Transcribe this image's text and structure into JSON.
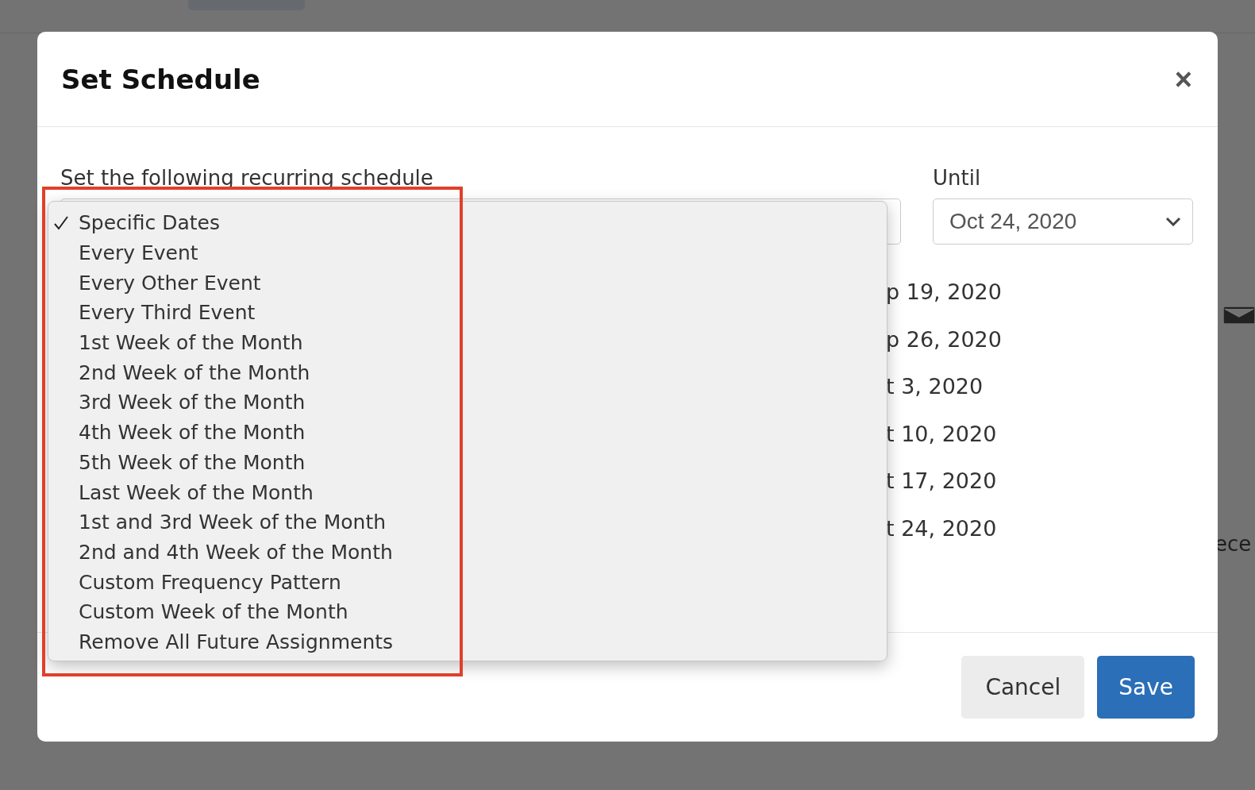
{
  "background": {
    "text": "ece"
  },
  "dialog": {
    "title": "Set Schedule",
    "close": "×",
    "schedule_label": "Set the following recurring schedule",
    "until_label": "Until",
    "until_value": "Oct 24, 2020",
    "dates": [
      "p 19, 2020",
      "p 26, 2020",
      "t 3, 2020",
      "t 10, 2020",
      "t 17, 2020",
      "t 24, 2020"
    ],
    "dropdown": [
      {
        "label": "Specific Dates",
        "selected": true
      },
      {
        "label": "Every Event",
        "selected": false
      },
      {
        "label": "Every Other Event",
        "selected": false
      },
      {
        "label": "Every Third Event",
        "selected": false
      },
      {
        "label": "1st Week of the Month",
        "selected": false
      },
      {
        "label": "2nd Week of the Month",
        "selected": false
      },
      {
        "label": "3rd Week of the Month",
        "selected": false
      },
      {
        "label": "4th Week of the Month",
        "selected": false
      },
      {
        "label": "5th Week of the Month",
        "selected": false
      },
      {
        "label": "Last Week of the Month",
        "selected": false
      },
      {
        "label": "1st and 3rd Week of the Month",
        "selected": false
      },
      {
        "label": "2nd and 4th Week of the Month",
        "selected": false
      },
      {
        "label": "Custom Frequency Pattern",
        "selected": false
      },
      {
        "label": "Custom Week of the Month",
        "selected": false
      },
      {
        "label": "Remove All Future Assignments",
        "selected": false
      }
    ],
    "buttons": [
      {
        "label": "Cancel",
        "kind": "secondary"
      },
      {
        "label": "Save",
        "kind": "primary"
      }
    ]
  }
}
